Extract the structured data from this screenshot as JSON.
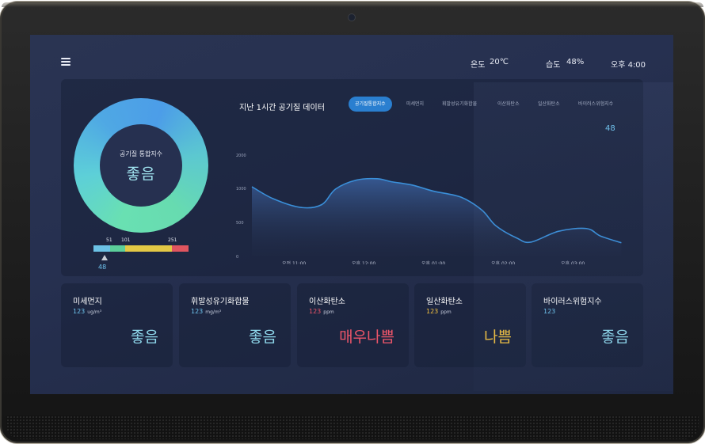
{
  "header": {
    "temperature_label": "온도",
    "temperature_value": "20℃",
    "humidity_label": "습도",
    "humidity_value": "48%",
    "time": "오후 4:00",
    "menu_icon": "hamburger-menu-icon"
  },
  "summary": {
    "label": "공기질 통합지수",
    "status": "좋음",
    "scale_breakpoints": [
      "51",
      "101",
      "251"
    ],
    "scale_colors": [
      "#6cc2e6",
      "#5ccf9a",
      "#e3c845",
      "#e0555f"
    ],
    "current_value": "48",
    "ring_colors": [
      "#69e0b2",
      "#4c9de8"
    ]
  },
  "chart_section": {
    "title": "지난 1시간 공기질 데이터",
    "tabs": [
      "공기질통합지수",
      "미세먼지",
      "휘발성유기화합물",
      "이산화탄소",
      "일산화탄소",
      "바이러스위험지수"
    ],
    "active_tab": "공기질통합지수",
    "current_reading": "48"
  },
  "chart_data": {
    "type": "area",
    "title": "",
    "xlabel": "",
    "ylabel": "",
    "x_ticks": [
      "오전 11:00",
      "오후 12:00",
      "오후 01:00",
      "오후 02:00",
      "오후 03:00",
      "오후 04:00"
    ],
    "y_ticks": [
      "2000",
      "1000",
      "500",
      "0"
    ],
    "ylim": [
      0,
      2000
    ],
    "grid": false,
    "color": "#3a8fd9",
    "series": [
      {
        "x": [
          0,
          0.3,
          0.7,
          1.0,
          1.2,
          1.5,
          1.8,
          2.0,
          2.3,
          2.6,
          3.0,
          3.3,
          3.5,
          3.8,
          4.0,
          4.4,
          4.8,
          5.0,
          5.3
        ],
        "values": [
          1050,
          850,
          720,
          760,
          990,
          1250,
          1290,
          1200,
          1100,
          960,
          870,
          680,
          450,
          270,
          210,
          370,
          410,
          300,
          200
        ]
      }
    ]
  },
  "cards": [
    {
      "title": "미세먼지",
      "value": "123",
      "unit": "ug/m³",
      "status": "좋음",
      "value_color": "#6fc4ee",
      "status_color": "#8fd8ec"
    },
    {
      "title": "휘발성유기화합물",
      "value": "123",
      "unit": "mg/m³",
      "status": "좋음",
      "value_color": "#6fc4ee",
      "status_color": "#8fd8ec"
    },
    {
      "title": "이산화탄소",
      "value": "123",
      "unit": "ppm",
      "status": "매우나쁨",
      "value_color": "#f0566a",
      "status_color": "#f0566a"
    },
    {
      "title": "일산화탄소",
      "value": "123",
      "unit": "ppm",
      "status": "나쁨",
      "value_color": "#f2c241",
      "status_color": "#f2c241"
    },
    {
      "title": "바이러스위험지수",
      "value": "123",
      "unit": "",
      "status": "좋음",
      "value_color": "#6fc4ee",
      "status_color": "#8fd8ec"
    }
  ]
}
